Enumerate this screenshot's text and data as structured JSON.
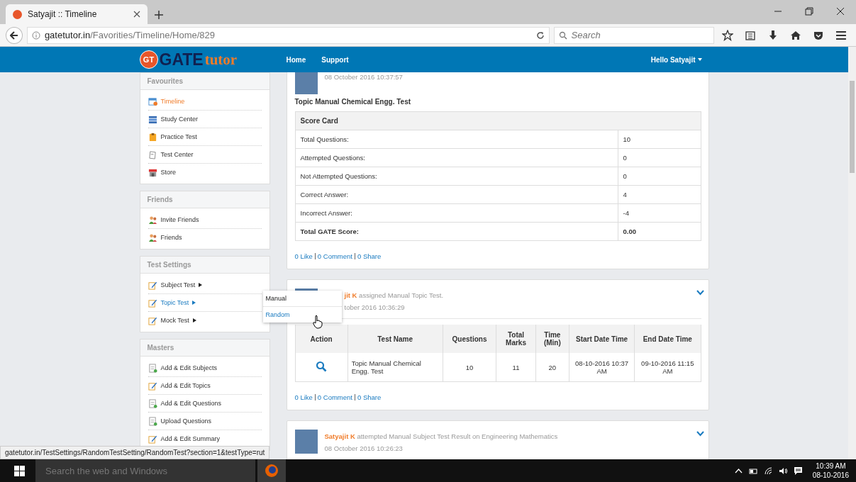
{
  "browser": {
    "tab": {
      "title": "Satyajit :: Timeline",
      "selected": true
    },
    "address": {
      "domain": "gatetutor.in",
      "path": "/Favorities/Timeline/Home/829"
    },
    "search": {
      "placeholder": "Search"
    }
  },
  "header": {
    "logo": {
      "badge": "GT",
      "word_1": "GATE",
      "word_2": "tutor"
    },
    "nav": [
      "Home",
      "Support"
    ],
    "user": "Hello Satyajit"
  },
  "sidebar": [
    {
      "title": "Favourites",
      "items": [
        {
          "label": "Timeline",
          "selected": true,
          "hovered": false,
          "submenu": false
        },
        {
          "label": "Study Center",
          "selected": false,
          "hovered": false,
          "submenu": false
        },
        {
          "label": "Practice Test",
          "selected": false,
          "hovered": false,
          "submenu": false
        },
        {
          "label": "Test Center",
          "selected": false,
          "hovered": false,
          "submenu": false
        },
        {
          "label": "Store",
          "selected": false,
          "hovered": false,
          "submenu": false
        }
      ]
    },
    {
      "title": "Friends",
      "items": [
        {
          "label": "Invite Friends",
          "selected": false,
          "hovered": false,
          "submenu": false
        },
        {
          "label": "Friends",
          "selected": false,
          "hovered": false,
          "submenu": false
        }
      ]
    },
    {
      "title": "Test Settings",
      "items": [
        {
          "label": "Subject Test",
          "selected": false,
          "hovered": false,
          "submenu": true
        },
        {
          "label": "Topic Test",
          "selected": false,
          "hovered": true,
          "submenu": true
        },
        {
          "label": "Mock Test",
          "selected": false,
          "hovered": false,
          "submenu": true
        }
      ]
    },
    {
      "title": "Masters",
      "items": [
        {
          "label": "Add & Edit Subjects",
          "selected": false,
          "hovered": false,
          "submenu": false
        },
        {
          "label": "Add & Edit Topics",
          "selected": false,
          "hovered": false,
          "submenu": false
        },
        {
          "label": "Add & Edit Questions",
          "selected": false,
          "hovered": false,
          "submenu": false
        },
        {
          "label": "Upload Questions",
          "selected": false,
          "hovered": false,
          "submenu": false
        },
        {
          "label": "Add & Edit Summary",
          "selected": false,
          "hovered": false,
          "submenu": false
        }
      ]
    }
  ],
  "popup_menu": {
    "items": [
      {
        "label": "Manual",
        "hovered": false
      },
      {
        "label": "Random",
        "hovered": true
      }
    ]
  },
  "feed": [
    {
      "kind": "score",
      "date": "08 October 2016 10:37:57",
      "test_title": "Topic Manual Chemical Engg. Test",
      "score_card": {
        "title": "Score Card",
        "rows": [
          {
            "label": "Total Questions:",
            "value": "10",
            "bold": false
          },
          {
            "label": "Attempted Questions:",
            "value": "0",
            "bold": false
          },
          {
            "label": "Not Attempted Questions:",
            "value": "0",
            "bold": false
          },
          {
            "label": "Correct Answer:",
            "value": "4",
            "bold": false
          },
          {
            "label": "Incorrect Answer:",
            "value": "-4",
            "bold": false
          },
          {
            "label": "Total GATE Score:",
            "value": "0.00",
            "bold": true
          }
        ]
      },
      "social": [
        "0 Like",
        "0 Comment",
        "0 Share"
      ]
    },
    {
      "kind": "assigned",
      "name": "jit K",
      "action": "assigned Manual Topic Test.",
      "date": "tober 2016 10:36:29",
      "table": {
        "columns": [
          "Action",
          "Test Name",
          "Questions",
          "Total Marks",
          "Time (Min)",
          "Start Date Time",
          "End Date Time"
        ],
        "rows": [
          {
            "test_name": "Topic Manual Chemical Engg. Test",
            "questions": "10",
            "total_marks": "11",
            "time": "20",
            "start": "08-10-2016 10:37 AM",
            "end": "09-10-2016 11:15 AM"
          }
        ]
      },
      "social": [
        "0 Like",
        "0 Comment",
        "0 Share"
      ]
    },
    {
      "kind": "attempted",
      "name": "Satyajit K",
      "action": "attempted Manual Subject Test Result on Engineering Mathematics",
      "date": "08 October 2016 10:26:23"
    }
  ],
  "status_bar": "gatetutor.in/TestSettings/RandomTestSetting/RandomTest?section=1&testType=rut",
  "taskbar": {
    "search_placeholder": "Search the web and Windows",
    "time": "10:39 AM",
    "date": "08-10-2016"
  }
}
